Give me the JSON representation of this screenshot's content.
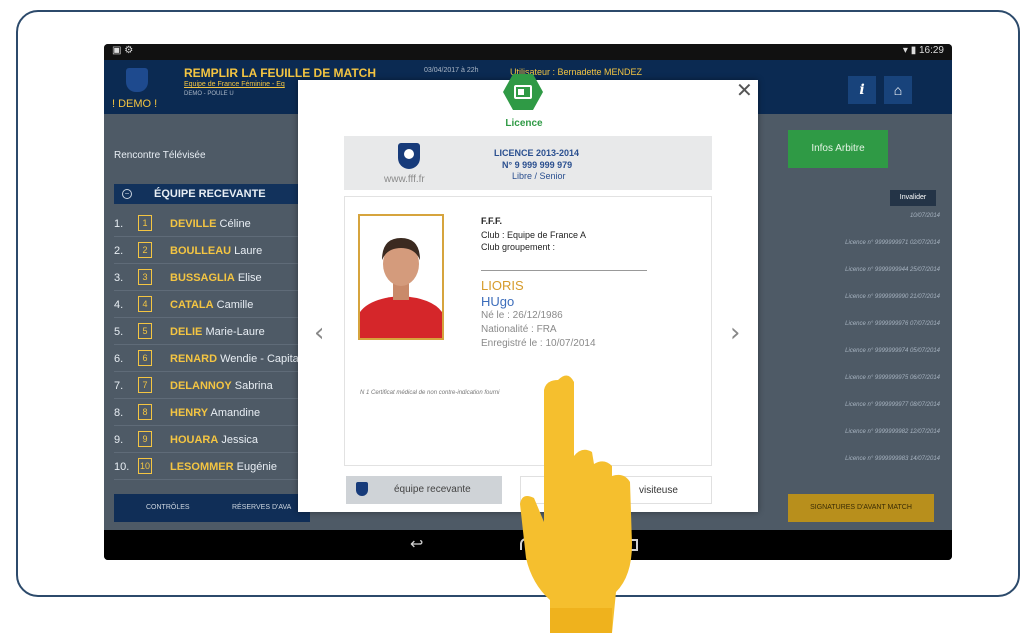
{
  "statusbar": {
    "left": "▣ ⚙",
    "right": "▾ ▮ 16:29"
  },
  "header": {
    "title": "REMPLIR LA FEUILLE DE MATCH",
    "subtitle": "Equipe de France Féminine - Eq",
    "subtitle2": "DEMO - POULE U",
    "date": "03/04/2017 à 22h",
    "referee": "Utilisateur : Bernadette MENDEZ",
    "demo": "! DEMO !"
  },
  "tv_label": "Rencontre Télévisée",
  "infos_button": "Infos Arbitre",
  "section_title": "ÉQUIPE RECEVANTE",
  "invalider": "Invalider",
  "players": [
    {
      "num": "1.",
      "badge": "1",
      "last": "DEVILLE",
      "first": " Céline"
    },
    {
      "num": "2.",
      "badge": "2",
      "last": "BOULLEAU",
      "first": " Laure"
    },
    {
      "num": "3.",
      "badge": "3",
      "last": "BUSSAGLIA",
      "first": " Elise"
    },
    {
      "num": "4.",
      "badge": "4",
      "last": "CATALA",
      "first": " Camille"
    },
    {
      "num": "5.",
      "badge": "5",
      "last": "DELIE",
      "first": " Marie-Laure"
    },
    {
      "num": "6.",
      "badge": "6",
      "last": "RENARD",
      "first": " Wendie - Capita"
    },
    {
      "num": "7.",
      "badge": "7",
      "last": "DELANNOY",
      "first": " Sabrina"
    },
    {
      "num": "8.",
      "badge": "8",
      "last": "HENRY",
      "first": " Amandine"
    },
    {
      "num": "9.",
      "badge": "9",
      "last": "HOUARA",
      "first": " Jessica"
    },
    {
      "num": "10.",
      "badge": "10",
      "last": "LESOMMER",
      "first": " Eugénie"
    }
  ],
  "licences": [
    "10/07/2014",
    "Licence n° 9999999971 02/07/2014",
    "Licence n° 9999999944 25/07/2014",
    "Licence n° 9999999990 21/07/2014",
    "Licence n° 9999999976 07/07/2014",
    "Licence n° 9999999974 05/07/2014",
    "Licence n° 9999999975 06/07/2014",
    "Licence n° 9999999977 08/07/2014",
    "Licence n° 9999999982 12/07/2014",
    "Licence n° 9999999983 14/07/2014"
  ],
  "footer": {
    "controls": "CONTRÔLES",
    "reserves": "RÉSERVES D'AVA",
    "signatures": "SIGNATURES D'AVANT MATCH"
  },
  "modal": {
    "icon_label": "Licence",
    "close": "✕",
    "www": "www.fff.fr",
    "lic1": "LICENCE 2013-2014",
    "lic2": "N° 9 999 999 979",
    "lic3": "Libre / Senior",
    "org": "F.F.F.",
    "club": "Club : Equipe de France A",
    "group": "Club groupement :",
    "last_name": "LIORIS",
    "first_name": "HUgo",
    "born": "Né le : 26/12/1986",
    "nationality": "Nationalité : FRA",
    "registered": "Enregistré le : 10/07/2014",
    "certificate": "N 1 Certificat médical de non contre-indication fourni",
    "team_home": "équipe recevante",
    "team_away": "visiteuse",
    "prev": "‹",
    "next": "›"
  }
}
